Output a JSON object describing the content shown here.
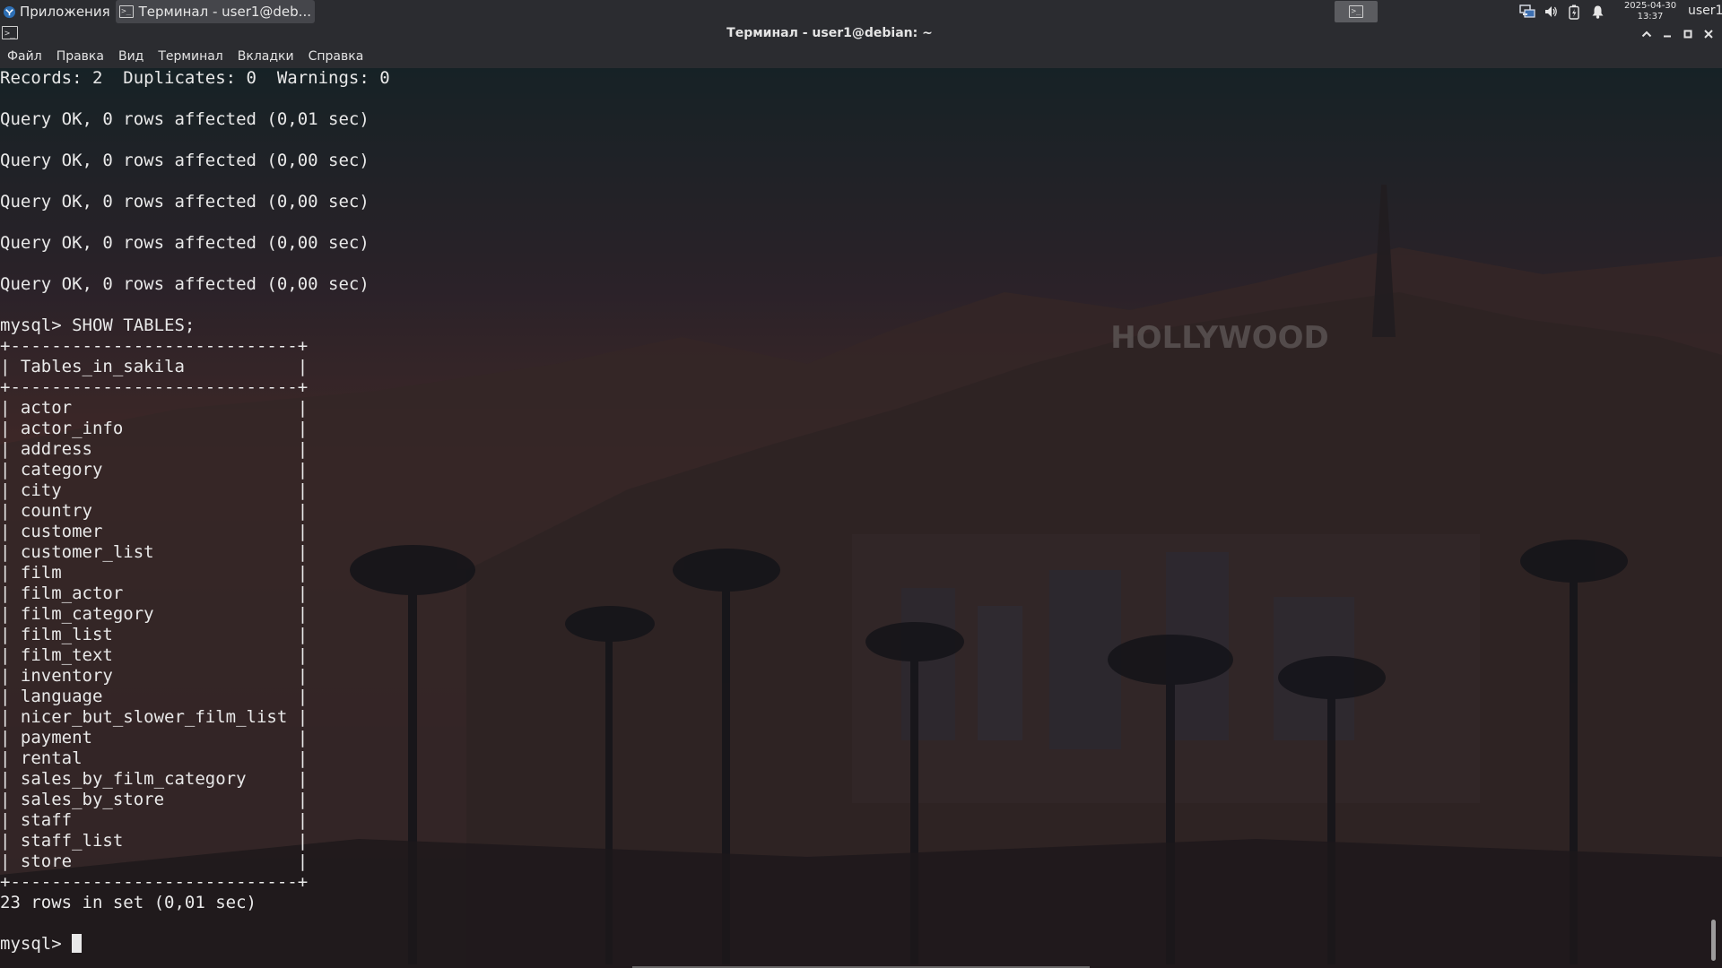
{
  "panel": {
    "apps_label": "Приложения",
    "task_label": "Терминал - user1@deb...",
    "clock_date": "2025-04-30",
    "clock_time": "13:37",
    "user": "user1",
    "tray_icons": [
      "network-icon",
      "volume-icon",
      "battery-icon",
      "notification-icon"
    ]
  },
  "window": {
    "title": "Терминал - user1@debian: ~",
    "menu": [
      "Файл",
      "Правка",
      "Вид",
      "Терминал",
      "Вкладки",
      "Справка"
    ]
  },
  "terminal": {
    "pre_lines": [
      "Records: 2  Duplicates: 0  Warnings: 0",
      "",
      "Query OK, 0 rows affected (0,01 sec)",
      "",
      "Query OK, 0 rows affected (0,00 sec)",
      "",
      "Query OK, 0 rows affected (0,00 sec)",
      "",
      "Query OK, 0 rows affected (0,00 sec)",
      "",
      "Query OK, 0 rows affected (0,00 sec)",
      "",
      "mysql> SHOW TABLES;"
    ],
    "table_border": "+----------------------------+",
    "table_header": "Tables_in_sakila",
    "table_rows": [
      "actor",
      "actor_info",
      "address",
      "category",
      "city",
      "country",
      "customer",
      "customer_list",
      "film",
      "film_actor",
      "film_category",
      "film_list",
      "film_text",
      "inventory",
      "language",
      "nicer_but_slower_film_list",
      "payment",
      "rental",
      "sales_by_film_category",
      "sales_by_store",
      "staff",
      "staff_list",
      "store"
    ],
    "result_line": "23 rows in set (0,01 sec)",
    "prompt": "mysql> "
  },
  "wallpaper": {
    "sign_text": "HOLLYWOOD"
  }
}
